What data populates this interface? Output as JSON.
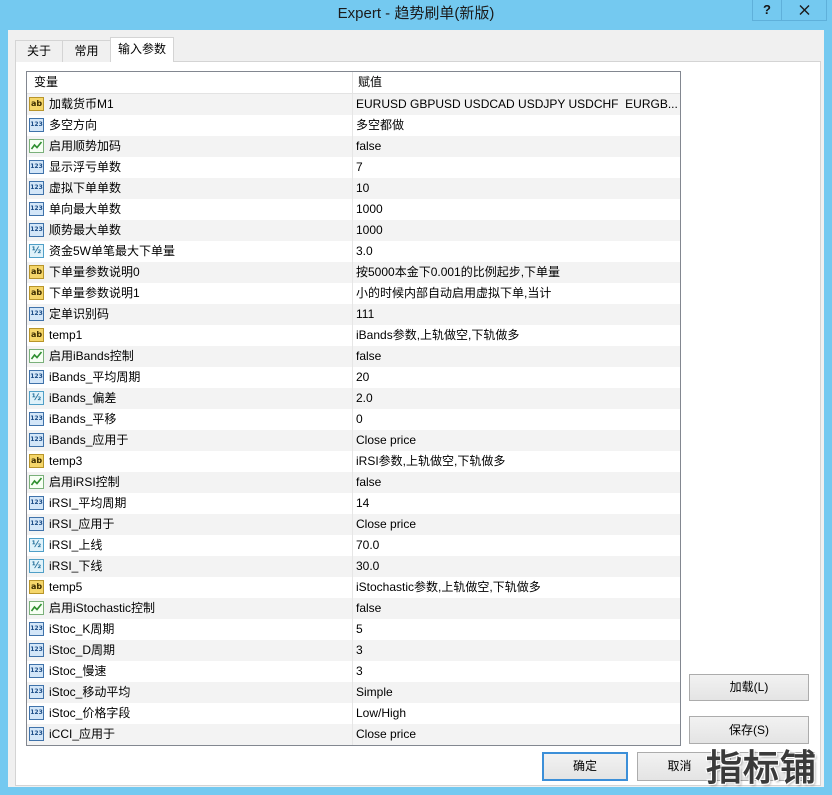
{
  "window": {
    "title": "Expert - 趋势刷单(新版)",
    "help_label": "?",
    "close_icon": "close-icon"
  },
  "tabs": [
    {
      "label": "关于",
      "active": false
    },
    {
      "label": "常用",
      "active": false
    },
    {
      "label": "输入参数",
      "active": true
    }
  ],
  "table": {
    "headers": {
      "variable": "变量",
      "value": "赋值"
    },
    "rows": [
      {
        "icon": "string-icon",
        "name": "加载货币M1",
        "value": "EURUSD GBPUSD USDCAD USDJPY USDCHF  EURGB..."
      },
      {
        "icon": "int-icon",
        "name": "多空方向",
        "value": "多空都做"
      },
      {
        "icon": "bool-icon",
        "name": "启用顺势加码",
        "value": "false"
      },
      {
        "icon": "int-icon",
        "name": "显示浮亏单数",
        "value": "7"
      },
      {
        "icon": "int-icon",
        "name": "虚拟下单单数",
        "value": "10"
      },
      {
        "icon": "int-icon",
        "name": "单向最大单数",
        "value": "1000"
      },
      {
        "icon": "int-icon",
        "name": "顺势最大单数",
        "value": "1000"
      },
      {
        "icon": "double-icon",
        "name": "资金5W单笔最大下单量",
        "value": "3.0"
      },
      {
        "icon": "string-icon",
        "name": "下单量参数说明0",
        "value": "按5000本金下0.001的比例起步,下单量"
      },
      {
        "icon": "string-icon",
        "name": "下单量参数说明1",
        "value": "小的时候内部自动启用虚拟下单,当计"
      },
      {
        "icon": "int-icon",
        "name": "定单识别码",
        "value": "111"
      },
      {
        "icon": "string-icon",
        "name": "temp1",
        "value": "iBands参数,上轨做空,下轨做多"
      },
      {
        "icon": "bool-icon",
        "name": "启用iBands控制",
        "value": "false"
      },
      {
        "icon": "int-icon",
        "name": "iBands_平均周期",
        "value": "20"
      },
      {
        "icon": "double-icon",
        "name": "iBands_偏差",
        "value": "2.0"
      },
      {
        "icon": "int-icon",
        "name": "iBands_平移",
        "value": "0"
      },
      {
        "icon": "int-icon",
        "name": "iBands_应用于",
        "value": "Close price"
      },
      {
        "icon": "string-icon",
        "name": "temp3",
        "value": "iRSI参数,上轨做空,下轨做多"
      },
      {
        "icon": "bool-icon",
        "name": "启用iRSI控制",
        "value": "false"
      },
      {
        "icon": "int-icon",
        "name": "iRSI_平均周期",
        "value": "14"
      },
      {
        "icon": "int-icon",
        "name": "iRSI_应用于",
        "value": "Close price"
      },
      {
        "icon": "double-icon",
        "name": "iRSI_上线",
        "value": "70.0"
      },
      {
        "icon": "double-icon",
        "name": "iRSI_下线",
        "value": "30.0"
      },
      {
        "icon": "string-icon",
        "name": "temp5",
        "value": "iStochastic参数,上轨做空,下轨做多"
      },
      {
        "icon": "bool-icon",
        "name": "启用iStochastic控制",
        "value": "false"
      },
      {
        "icon": "int-icon",
        "name": "iStoc_K周期",
        "value": "5"
      },
      {
        "icon": "int-icon",
        "name": "iStoc_D周期",
        "value": "3"
      },
      {
        "icon": "int-icon",
        "name": "iStoc_慢速",
        "value": "3"
      },
      {
        "icon": "int-icon",
        "name": "iStoc_移动平均",
        "value": "Simple"
      },
      {
        "icon": "int-icon",
        "name": "iStoc_价格字段",
        "value": "Low/High"
      },
      {
        "icon": "int-icon",
        "name": "iCCI_应用于",
        "value": "Close price"
      }
    ]
  },
  "side_buttons": {
    "load": "加载(L)",
    "save": "保存(S)"
  },
  "footer_buttons": {
    "ok": "确定",
    "cancel": "取消"
  },
  "watermark": "指标铺",
  "colors": {
    "frame": "#74c9f0",
    "default_button_border": "#3c8fd8",
    "alt_row": "#f3f3f3"
  }
}
